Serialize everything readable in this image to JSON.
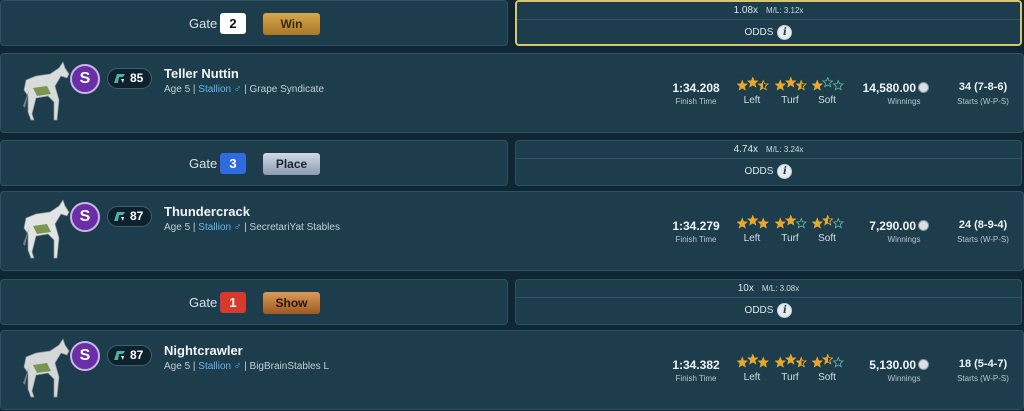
{
  "gates": [
    {
      "label": "Gate",
      "number": "2",
      "number_color": "white",
      "position": "Win",
      "position_style": "win",
      "odds": "1.08x",
      "ml": "M/L: 3.12x",
      "odds_label": "ODDS",
      "selected": true
    },
    {
      "label": "Gate",
      "number": "3",
      "number_color": "blue",
      "position": "Place",
      "position_style": "place",
      "odds": "4.74x",
      "ml": "M/L: 3.24x",
      "odds_label": "ODDS",
      "selected": false
    },
    {
      "label": "Gate",
      "number": "1",
      "number_color": "red",
      "position": "Show",
      "position_style": "show",
      "odds": "10x",
      "ml": "M/L: 3.08x",
      "odds_label": "ODDS",
      "selected": false
    }
  ],
  "horses": [
    {
      "badge": "S",
      "rating": "85",
      "name": "Teller Nuttin",
      "age": "Age 5",
      "sex": "Stallion ♂",
      "stable": "Grape Syndicate",
      "finish_time": "1:34.208",
      "finish_label": "Finish Time",
      "left_stars": 2.5,
      "turf_stars": 2.5,
      "soft_stars": 1,
      "left_label": "Left",
      "turf_label": "Turf",
      "soft_label": "Soft",
      "winnings": "14,580.00",
      "winnings_label": "Winnings",
      "starts": "34 (7-8-6)",
      "starts_label": "Starts (W-P-S)"
    },
    {
      "badge": "S",
      "rating": "87",
      "name": "Thundercrack",
      "age": "Age 5",
      "sex": "Stallion ♂",
      "stable": "SecretariYat Stables",
      "finish_time": "1:34.279",
      "finish_label": "Finish Time",
      "left_stars": 3,
      "turf_stars": 2,
      "soft_stars": 1.5,
      "left_label": "Left",
      "turf_label": "Turf",
      "soft_label": "Soft",
      "winnings": "7,290.00",
      "winnings_label": "Winnings",
      "starts": "24 (8-9-4)",
      "starts_label": "Starts (W-P-S)"
    },
    {
      "badge": "S",
      "rating": "87",
      "name": "Nightcrawler",
      "age": "Age 5",
      "sex": "Stallion ♂",
      "stable": "BigBrainStables L",
      "finish_time": "1:34.382",
      "finish_label": "Finish Time",
      "left_stars": 3,
      "turf_stars": 2.5,
      "soft_stars": 1.5,
      "left_label": "Left",
      "turf_label": "Turf",
      "soft_label": "Soft",
      "winnings": "5,130.00",
      "winnings_label": "Winnings",
      "starts": "18 (5-4-7)",
      "starts_label": "Starts (W-P-S)"
    }
  ],
  "colors": {
    "background": "#0f2634",
    "panel": "#1d3c4c",
    "star": "#e8a92a",
    "star_empty": "#5fb5a6",
    "selected_border": "#d9c673"
  },
  "icons": {
    "info": "info-icon",
    "coin": "coin-icon",
    "rating": "rating-icon",
    "horse": "horse-icon"
  }
}
